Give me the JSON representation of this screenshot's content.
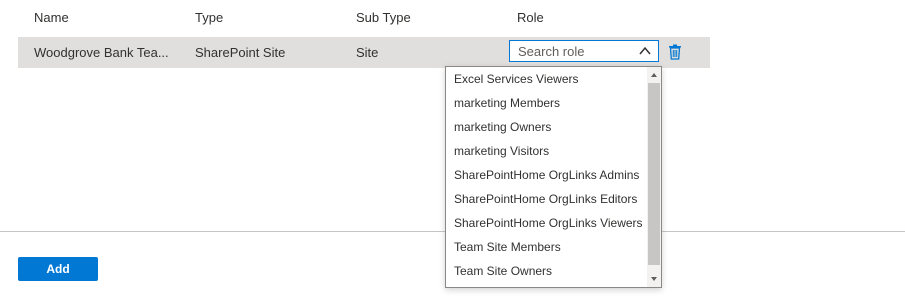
{
  "table": {
    "headers": {
      "name": "Name",
      "type": "Type",
      "sub_type": "Sub Type",
      "role": "Role"
    },
    "rows": [
      {
        "name": "Woodgrove Bank Tea...",
        "type": "SharePoint Site",
        "sub_type": "Site",
        "role_placeholder": "Search role"
      }
    ]
  },
  "role_dropdown": {
    "expanded": true,
    "options": [
      "Excel Services Viewers",
      "marketing Members",
      "marketing Owners",
      "marketing Visitors",
      "SharePointHome OrgLinks Admins",
      "SharePointHome OrgLinks Editors",
      "SharePointHome OrgLinks Viewers",
      "Team Site Members",
      "Team Site Owners"
    ]
  },
  "icons": {
    "chevron": "chevron-up-icon",
    "delete": "trash-icon",
    "scroll_up": "scroll-up-arrow-icon",
    "scroll_down": "scroll-down-arrow-icon"
  },
  "actions": {
    "add_label": "Add"
  },
  "colors": {
    "accent": "#0078d4",
    "row_background": "#e1dfdd",
    "divider": "#c8c6c4"
  }
}
